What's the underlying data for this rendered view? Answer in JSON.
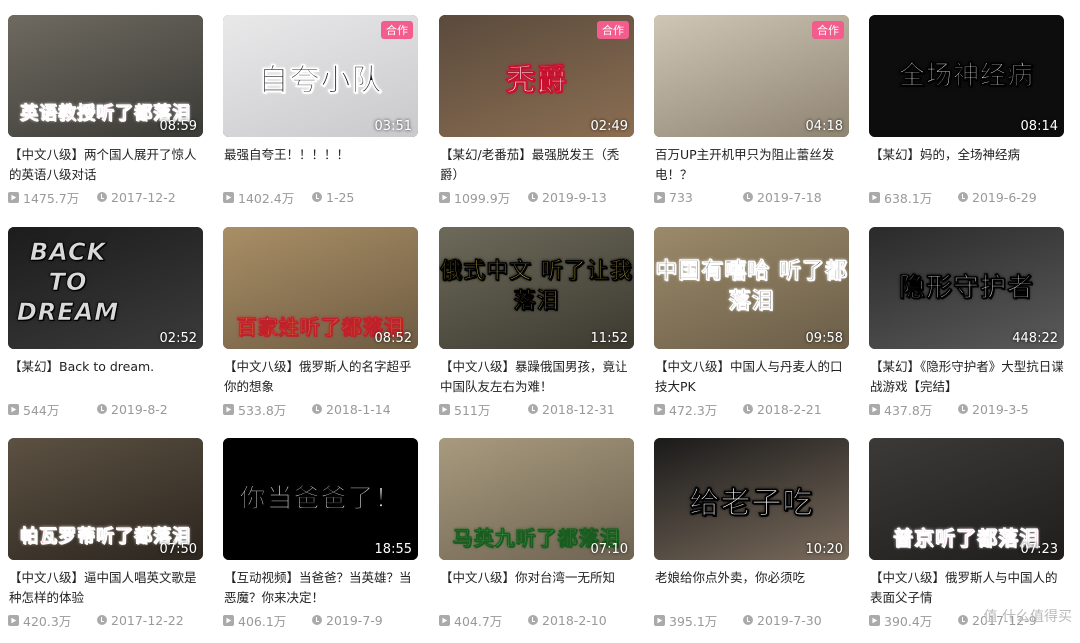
{
  "videos": [
    {
      "title": "【中文八级】两个国人展开了惊人的英语八级对话",
      "duration": "08:59",
      "views": "1475.7万",
      "date": "2017-12-2",
      "overlay": "英语教授听了都落泪",
      "badge": "",
      "bg": [
        "#6f6a60",
        "#3a3a36"
      ],
      "overlay_color": "#ff6fb5",
      "overlay_stroke": "#ffffff"
    },
    {
      "title": "最强自夸王！！！！！",
      "duration": "03:51",
      "views": "1402.4万",
      "date": "1-25",
      "overlay": "自夸小队",
      "badge": "合作",
      "bg": [
        "#e9e9ea",
        "#c9c9cc"
      ],
      "overlay_color": "#111111",
      "overlay_stroke": "#ffffff"
    },
    {
      "title": "【某幻/老番茄】最强脱发王（秃爵）",
      "duration": "02:49",
      "views": "1099.9万",
      "date": "2019-9-13",
      "overlay": "秃爵",
      "badge": "合作",
      "bg": [
        "#5a4a3c",
        "#8b6e52"
      ],
      "overlay_color": "#ffffff",
      "overlay_stroke": "#c8102e"
    },
    {
      "title": "百万UP主开机甲只为阻止蕾丝发电！？",
      "duration": "04:18",
      "views": "733",
      "date": "2019-7-18",
      "overlay": "",
      "badge": "合作",
      "bg": [
        "#cfc6b6",
        "#8f8472"
      ],
      "overlay_color": "#ffffff",
      "overlay_stroke": "#000000"
    },
    {
      "title": "【某幻】妈的，全场神经病",
      "duration": "08:14",
      "views": "638.1万",
      "date": "2019-6-29",
      "overlay": "全场神经病",
      "badge": "",
      "bg": [
        "#0d0d0d",
        "#0d0d0d"
      ],
      "overlay_color": "#ffffff",
      "overlay_stroke": "#000000"
    },
    {
      "title": "【某幻】Back to dream.",
      "duration": "02:52",
      "views": "544万",
      "date": "2019-8-2",
      "overlay": "BACK TO DREAM",
      "badge": "",
      "bg": [
        "#1c1c1c",
        "#3b3b3b"
      ],
      "overlay_color": "#d9d9d9",
      "overlay_stroke": "#000000"
    },
    {
      "title": "【中文八级】俄罗斯人的名字超乎你的想象",
      "duration": "08:52",
      "views": "533.8万",
      "date": "2018-1-14",
      "overlay": "百家姓听了都落泪",
      "badge": "",
      "bg": [
        "#a98f66",
        "#6e5b42"
      ],
      "overlay_color": "#ffe14a",
      "overlay_stroke": "#c0202a"
    },
    {
      "title": "【中文八级】暴躁俄国男孩，竟让中国队友左右为难！",
      "duration": "11:52",
      "views": "511万",
      "date": "2018-12-31",
      "overlay": "俄式中文 听了让我落泪",
      "badge": "",
      "bg": [
        "#6d6a5a",
        "#3c3a30"
      ],
      "overlay_color": "#ffe14a",
      "overlay_stroke": "#000000"
    },
    {
      "title": "【中文八级】中国人与丹麦人的口技大PK",
      "duration": "09:58",
      "views": "472.3万",
      "date": "2018-2-21",
      "overlay": "中国有嘻哈 听了都落泪",
      "badge": "",
      "bg": [
        "#9b8a6a",
        "#6b5e48"
      ],
      "overlay_color": "#111111",
      "overlay_stroke": "#ffffff"
    },
    {
      "title": "【某幻】《隐形守护者》大型抗日谍战游戏【完结】",
      "duration": "448:22",
      "views": "437.8万",
      "date": "2019-3-5",
      "overlay": "隐形守护者",
      "badge": "",
      "bg": [
        "#2a2a2a",
        "#5a5a5a"
      ],
      "overlay_color": "#e8e8e8",
      "overlay_stroke": "#000000"
    },
    {
      "title": "【中文八级】逼中国人唱英文歌是种怎样的体验",
      "duration": "07:50",
      "views": "420.3万",
      "date": "2017-12-22",
      "overlay": "帕瓦罗蒂听了都落泪",
      "badge": "",
      "bg": [
        "#5c5142",
        "#2c261f"
      ],
      "overlay_color": "#ff5a7a",
      "overlay_stroke": "#ffffff"
    },
    {
      "title": "【互动视频】当爸爸？当英雄？当恶魔？你来决定！",
      "duration": "18:55",
      "views": "406.1万",
      "date": "2019-7-9",
      "overlay": "你当爸爸了！",
      "badge": "",
      "bg": [
        "#000000",
        "#000000"
      ],
      "overlay_color": "#ffffff",
      "overlay_stroke": "#000000"
    },
    {
      "title": "【中文八级】你对台湾一无所知",
      "duration": "07:10",
      "views": "404.7万",
      "date": "2018-2-10",
      "overlay": "马英九听了都落泪",
      "badge": "",
      "bg": [
        "#a89a7e",
        "#6f6452"
      ],
      "overlay_color": "#56e06a",
      "overlay_stroke": "#1a5c20"
    },
    {
      "title": "老娘给你点外卖，你必须吃",
      "duration": "10:20",
      "views": "395.1万",
      "date": "2019-7-30",
      "overlay": "给老子吃",
      "badge": "",
      "bg": [
        "#1a1a1a",
        "#7a6b5c"
      ],
      "overlay_color": "#ffffff",
      "overlay_stroke": "#000000"
    },
    {
      "title": "【中文八级】俄罗斯人与中国人的表面父子情",
      "duration": "07:23",
      "views": "390.4万",
      "date": "2017-12-9",
      "overlay": "普京听了都落泪",
      "badge": "",
      "bg": [
        "#3c3a38",
        "#1f1e1d"
      ],
      "overlay_color": "#ff6fb5",
      "overlay_stroke": "#ffffff"
    }
  ],
  "icons": {
    "views": "play-count-icon",
    "date": "clock-icon"
  },
  "watermark": "值 什么值得买"
}
